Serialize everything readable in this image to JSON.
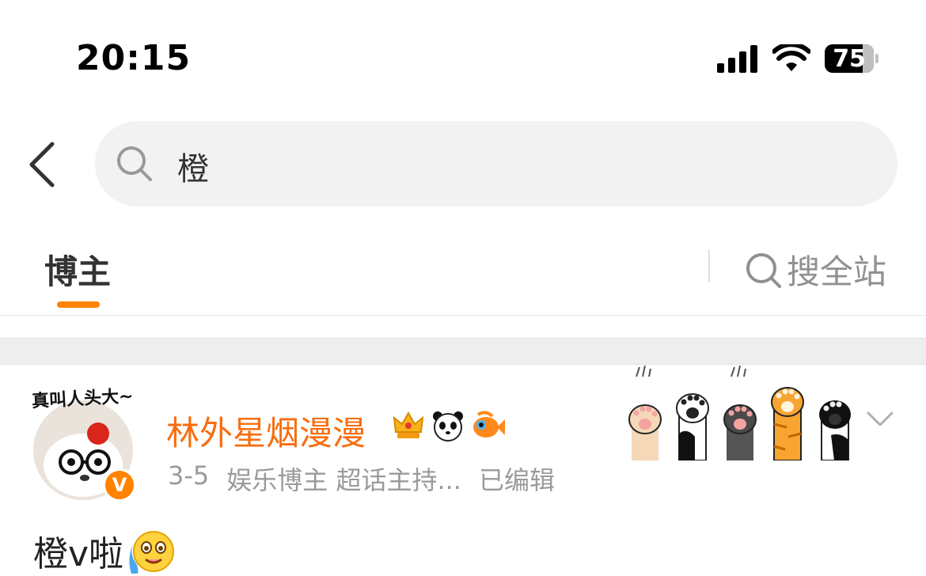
{
  "status_bar": {
    "time": "20:15",
    "battery": "75"
  },
  "search": {
    "query": "橙"
  },
  "tabs": {
    "active": "博主",
    "search_all": "搜全站"
  },
  "post": {
    "avatar_caption": "真叫人头大~",
    "author": "林外星烟漫漫",
    "badge_icons": [
      "crown-icon",
      "panda-icon",
      "fish-icon"
    ],
    "date": "3-5",
    "tags": "娱乐博主 超话主持...",
    "edited": "已编辑",
    "content": "橙v啦",
    "content_emoji": "crying-happy-emoji-icon",
    "verified": "V"
  },
  "colors": {
    "accent": "#ff8200",
    "username": "#f86d0e",
    "meta": "#9a9a9a"
  }
}
